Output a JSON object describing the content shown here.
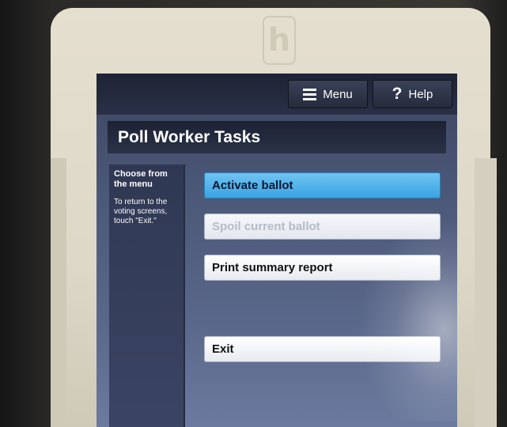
{
  "device": {
    "logo_glyph": "h"
  },
  "topbar": {
    "menu_label": "Menu",
    "help_label": "Help",
    "menu_icon": "hamburger-icon",
    "help_icon": "question-mark-icon",
    "help_glyph": "?"
  },
  "page_title": "Poll Worker Tasks",
  "sidebar": {
    "title": "Choose from the menu",
    "body": "To return to the voting screens, touch \"Exit.\""
  },
  "tasks": [
    {
      "label": "Activate ballot",
      "state": "highlighted"
    },
    {
      "label": "Spoil current ballot",
      "state": "disabled"
    },
    {
      "label": "Print summary report",
      "state": "enabled"
    },
    {
      "label": "Exit",
      "state": "enabled"
    }
  ],
  "colors": {
    "highlight": "#39a3e2",
    "screen_bg": "#4a5675",
    "bezel": "#ddd8c7"
  }
}
